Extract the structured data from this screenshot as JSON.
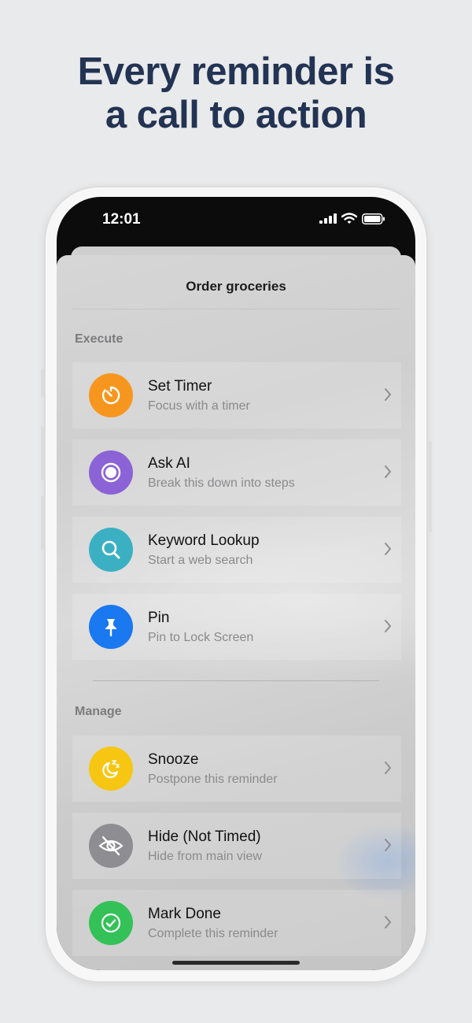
{
  "headline": {
    "line1": "Every reminder is",
    "line2": "a call to action"
  },
  "status_bar": {
    "time": "12:01"
  },
  "sheet": {
    "title": "Order groceries"
  },
  "sections": [
    {
      "label": "Execute",
      "items": [
        {
          "title": "Set Timer",
          "subtitle": "Focus with a timer",
          "icon": "timer-icon",
          "color": "#f7961e"
        },
        {
          "title": "Ask AI",
          "subtitle": "Break this down into steps",
          "icon": "ai-icon",
          "color": "#8c63d6"
        },
        {
          "title": "Keyword Lookup",
          "subtitle": "Start a web search",
          "icon": "search-icon",
          "color": "#3cb0c3"
        },
        {
          "title": "Pin",
          "subtitle": "Pin to Lock Screen",
          "icon": "pin-icon",
          "color": "#1a78f0"
        }
      ]
    },
    {
      "label": "Manage",
      "items": [
        {
          "title": "Snooze",
          "subtitle": "Postpone this reminder",
          "icon": "moon-zzz-icon",
          "color": "#f7c613"
        },
        {
          "title": "Hide (Not Timed)",
          "subtitle": "Hide from main view",
          "icon": "eye-slash-icon",
          "color": "#8e8e92"
        },
        {
          "title": "Mark Done",
          "subtitle": "Complete this reminder",
          "icon": "checkmark-icon",
          "color": "#33c158"
        }
      ]
    }
  ]
}
